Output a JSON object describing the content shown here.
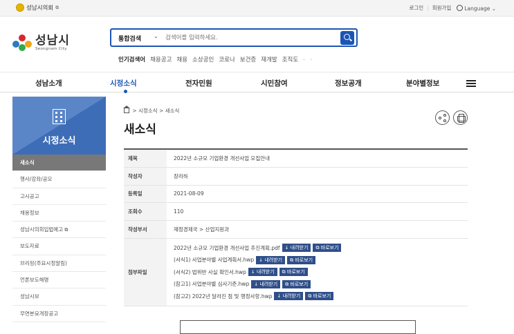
{
  "top": {
    "council": "성남시의회",
    "login": "로그인",
    "signup": "회원가입",
    "language": "Language"
  },
  "logo": {
    "ko": "성남시",
    "en": "Seongnam City"
  },
  "search": {
    "category": "통합검색",
    "placeholder": "검색어를 입력하세요."
  },
  "popular": {
    "label": "인기검색어",
    "terms": [
      "채용공고",
      "채용",
      "소상공인",
      "코로나",
      "보건증",
      "재개발",
      "조직도"
    ]
  },
  "gnb": [
    "성남소개",
    "시정소식",
    "전자민원",
    "시민참여",
    "정보공개",
    "분야별정보"
  ],
  "side": {
    "title": "시정소식",
    "items": [
      "새소식",
      "행사/강좌/공모",
      "고시공고",
      "채용정보",
      "성남시의회입법예고",
      "보도자료",
      "브리핑(주요시정알림)",
      "언론보도해명",
      "성남시보",
      "무연분묘개장공고"
    ]
  },
  "breadcrumb": [
    "시정소식",
    "새소식"
  ],
  "page_title": "새소식",
  "info": {
    "labels": {
      "subject": "제목",
      "author": "작성자",
      "date": "등록일",
      "views": "조회수",
      "dept": "작성부서",
      "files": "첨부파일"
    },
    "subject": "2022년 소규모 기업환경 개선사업 모집안내",
    "author": "장리하",
    "date": "2021-08-09",
    "views": "110",
    "dept": "재정경제국 > 산업지원과"
  },
  "files": [
    "2022년 소규모 기업환경 개선사업 추진계획.pdf",
    "(서식1) 사업분야별 사업계획서.hwp",
    "(서식2) 법위반 사실 확인서.hwp",
    "(참고1) 사업분야별 심사기준.hwp",
    "(참고2) 2022년 달라진 점 및 행정사항.hwp"
  ],
  "file_buttons": {
    "download": "내려받기",
    "view": "바로보기"
  },
  "colors": {
    "primary": "#1b55b4",
    "side_hero": "#3e6db7",
    "file_button": "#2f4f8a"
  }
}
